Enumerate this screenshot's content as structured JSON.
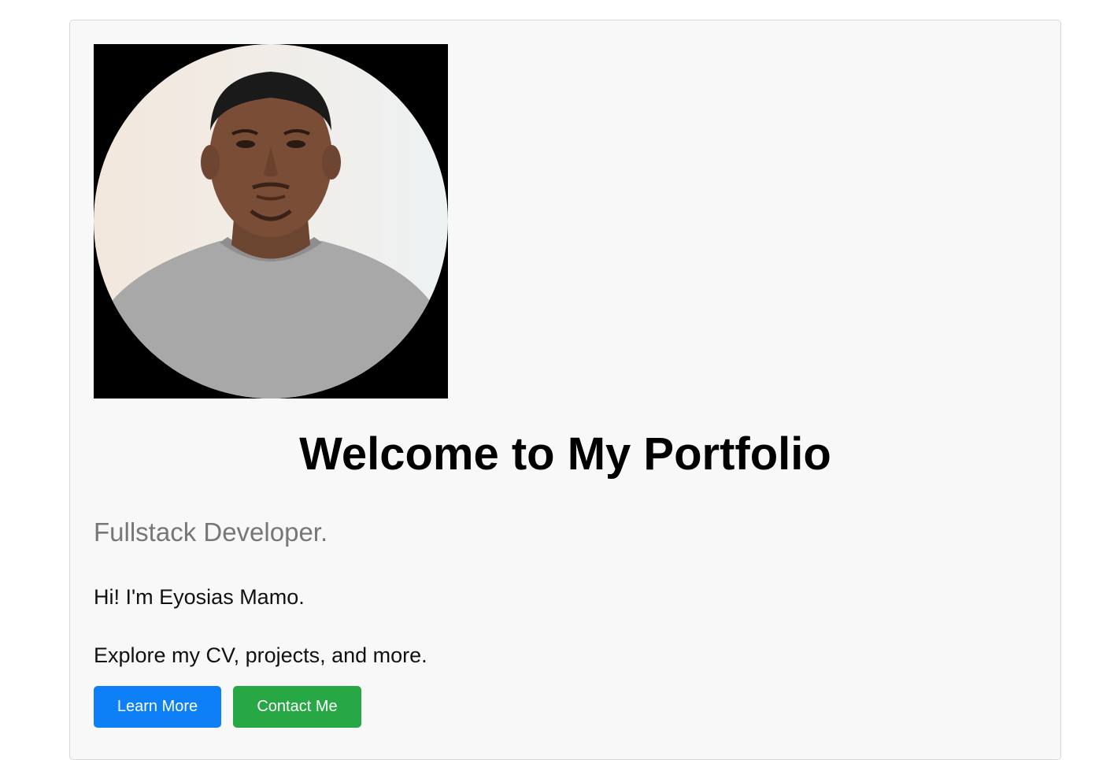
{
  "hero": {
    "title": "Welcome to My Portfolio",
    "subtitle": "Fullstack Developer.",
    "intro": "Hi! I'm Eyosias Mamo.",
    "explore": "Explore my CV, projects, and more."
  },
  "buttons": {
    "learn_more": "Learn More",
    "contact_me": "Contact Me"
  },
  "colors": {
    "primary": "#0d7ff7",
    "success": "#28a745",
    "card_background": "#f8f8f8",
    "subtitle_text": "#777777"
  }
}
